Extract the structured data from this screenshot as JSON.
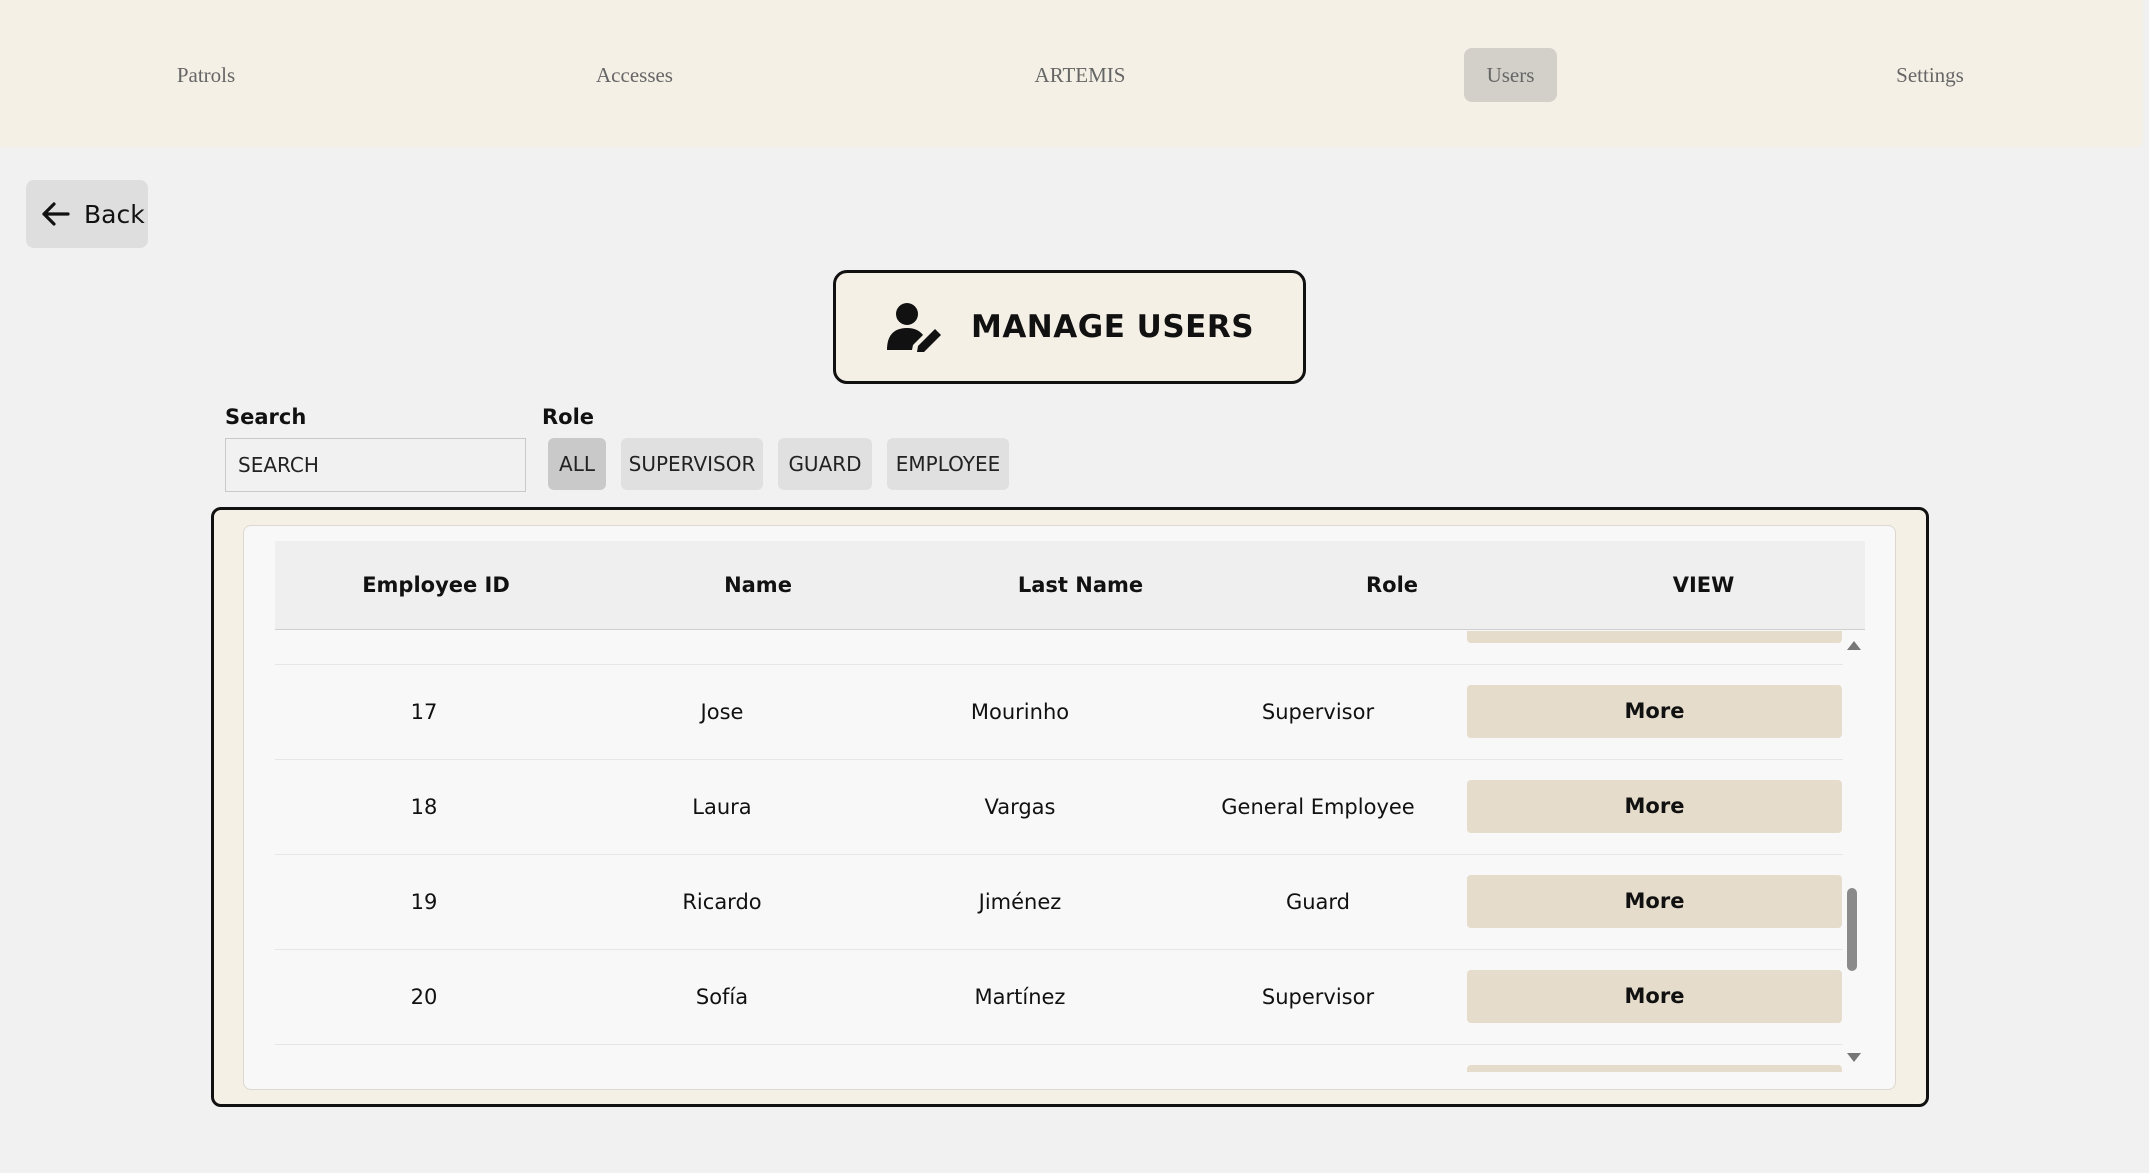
{
  "nav": {
    "items": [
      {
        "label": "Patrols"
      },
      {
        "label": "Accesses"
      },
      {
        "label": "ARTEMIS"
      },
      {
        "label": "Users"
      },
      {
        "label": "Settings"
      }
    ],
    "active": "Users"
  },
  "back": {
    "label": "Back",
    "icon": "arrow-left-icon"
  },
  "title": {
    "text": "MANAGE USERS",
    "icon": "user-edit-icon"
  },
  "search": {
    "label": "Search",
    "value": "SEARCH"
  },
  "role_filter": {
    "label": "Role",
    "options": [
      "ALL",
      "SUPERVISOR",
      "GUARD",
      "EMPLOYEE"
    ],
    "selected": "ALL"
  },
  "table": {
    "columns": [
      "Employee ID",
      "Name",
      "Last Name",
      "Role",
      "VIEW"
    ],
    "rows": [
      {
        "id": "17",
        "name": "Jose",
        "last_name": "Mourinho",
        "role": "Supervisor",
        "action": "More"
      },
      {
        "id": "18",
        "name": "Laura",
        "last_name": "Vargas",
        "role": "General Employee",
        "action": "More"
      },
      {
        "id": "19",
        "name": "Ricardo",
        "last_name": "Jiménez",
        "role": "Guard",
        "action": "More"
      },
      {
        "id": "20",
        "name": "Sofía",
        "last_name": "Martínez",
        "role": "Supervisor",
        "action": "More"
      }
    ]
  },
  "colors": {
    "nav_bg": "#f5f0e6",
    "nav_active": "#d3cfc9",
    "more_button": "#e5dccb",
    "page_bg": "#f1f1f1"
  }
}
